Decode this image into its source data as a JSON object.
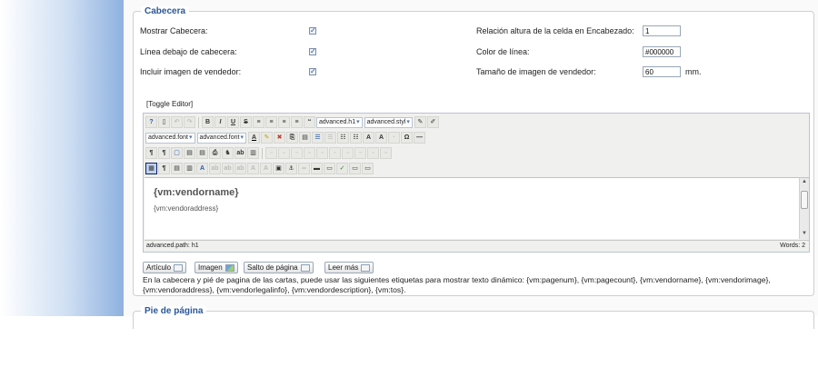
{
  "section1": {
    "title": "Cabecera",
    "left_rows": [
      {
        "label": "Mostrar Cabecera:",
        "checked": "✓"
      },
      {
        "label": "Línea debajo de cabecera:",
        "checked": "✓"
      },
      {
        "label": "Incluir imagen de vendedor:",
        "checked": "✓"
      }
    ],
    "right_rows": [
      {
        "label": "Relación altura de la celda en Encabezado:",
        "value": "1",
        "unit": ""
      },
      {
        "label": "Color de línea:",
        "value": "#000000",
        "unit": ""
      },
      {
        "label": "Tamaño de imagen de vendedor:",
        "value": "60",
        "unit": "mm."
      }
    ],
    "toggle_editor": "[Toggle Editor]"
  },
  "editor": {
    "toolbar1": {
      "buttons1": [
        "?",
        "▯",
        "↶",
        "↷"
      ],
      "bold": "B",
      "italic": "I",
      "underline": "U",
      "strike": "S",
      "align_buttons": [
        "≡",
        "≡",
        "≡",
        "≡",
        "“"
      ],
      "format_select": "advanced.h1",
      "style_select": "advanced.styl",
      "tail_buttons": [
        "✎",
        "✐"
      ]
    },
    "toolbar2": {
      "font_select": "advanced.font",
      "size_select": "advanced.font",
      "buttons": [
        "A",
        "✎",
        "✖",
        "⎘",
        "▤",
        "☰",
        "☰",
        "☷",
        "☷",
        "A",
        "A",
        "·",
        "Ω",
        "—"
      ]
    },
    "toolbar3": {
      "buttons": [
        "¶",
        "¶",
        "▢",
        "▤",
        "▤",
        "⎙",
        "♞",
        "ab",
        "▥",
        "▫",
        "▫",
        "▫",
        "▫",
        "▫",
        "▫",
        "▫",
        "▫",
        "▫",
        "▫"
      ]
    },
    "toolbar4": {
      "buttons": [
        "▦",
        "¶",
        "▤",
        "▥",
        "A",
        "ab",
        "ab",
        "ab",
        "A",
        "A",
        "▣",
        "⚓",
        "∞",
        "▬",
        "▭",
        "✓",
        "▭",
        "▭"
      ]
    },
    "content": {
      "heading": "{vm:vendorname}",
      "paragraph": "{vm:vendoraddress}"
    },
    "status_path": "advanced.path: h1",
    "status_words": "Words: 2"
  },
  "extensions": [
    {
      "label": "Artículo",
      "icon": "article-icon"
    },
    {
      "label": "Imagen",
      "icon": "image-icon"
    },
    {
      "label": "Salto de página",
      "icon": "pagebreak-icon"
    },
    {
      "label": "Leer más",
      "icon": "readmore-icon"
    }
  ],
  "help_text": "En la cabecera y pié de pagina de las cartas, puede usar las siguientes etiquetas para mostrar texto dinámico: {vm:pagenum}, {vm:pagecount}, {vm:vendorname}, {vm:vendorimage}, {vm:vendoraddress}, {vm:vendorlegalinfo}, {vm:vendordescription}, {vm:tos}.",
  "section2": {
    "title": "Pie de página"
  }
}
